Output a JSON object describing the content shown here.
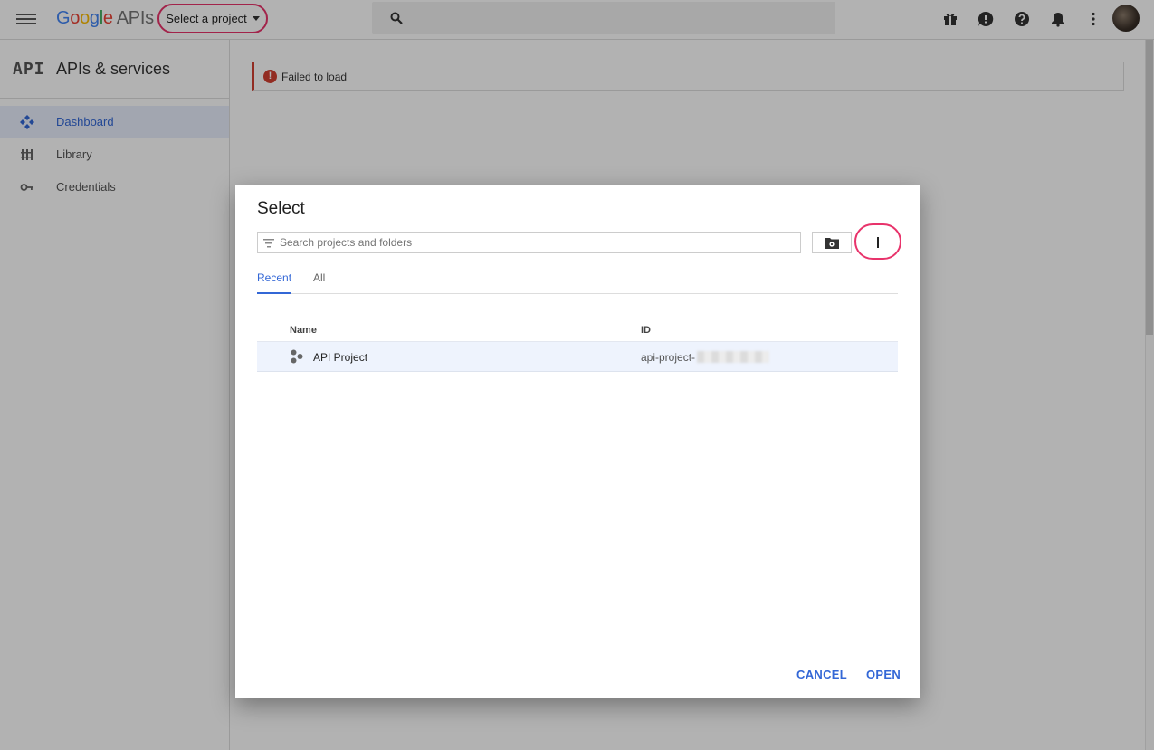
{
  "header": {
    "logo_google": [
      "G",
      "o",
      "o",
      "g",
      "l",
      "e"
    ],
    "logo_apis": "APIs",
    "project_selector": "Select a project",
    "icons": [
      "menu-icon",
      "search-icon",
      "gift-icon",
      "feedback-icon",
      "help-icon",
      "notifications-icon",
      "more-vert-icon",
      "avatar"
    ]
  },
  "sidebar": {
    "brand_mark": "API",
    "title": "APIs & services",
    "items": [
      {
        "label": "Dashboard",
        "icon": "dashboard-icon",
        "active": true
      },
      {
        "label": "Library",
        "icon": "library-icon",
        "active": false
      },
      {
        "label": "Credentials",
        "icon": "key-icon",
        "active": false
      }
    ]
  },
  "main": {
    "error_icon": "!",
    "error_text": "Failed to load"
  },
  "dialog": {
    "title": "Select",
    "search_placeholder": "Search projects and folders",
    "tabs": [
      {
        "label": "Recent",
        "active": true
      },
      {
        "label": "All",
        "active": false
      }
    ],
    "columns": {
      "name": "Name",
      "id": "ID"
    },
    "rows": [
      {
        "name": "API Project",
        "id_visible": "api-project-"
      }
    ],
    "cancel_label": "CANCEL",
    "open_label": "OPEN"
  },
  "colors": {
    "accent": "#3367d6",
    "highlight_ring": "#e8336b",
    "error": "#d23f31"
  }
}
